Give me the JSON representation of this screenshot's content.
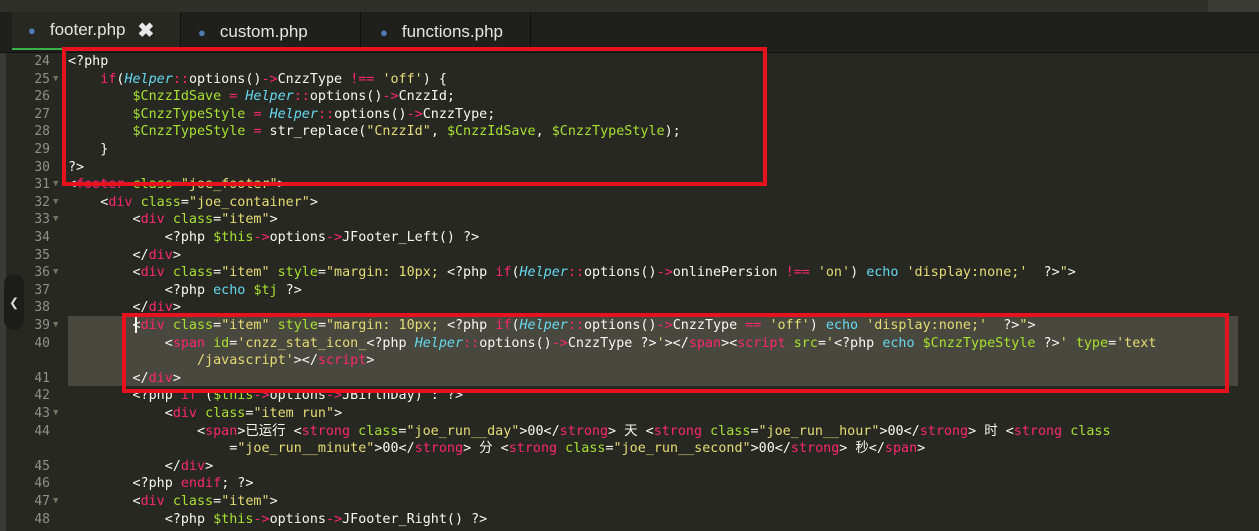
{
  "tabs": [
    {
      "label": "footer.php",
      "active": true,
      "close": "✖"
    },
    {
      "label": "custom.php",
      "active": false
    },
    {
      "label": "functions.php",
      "active": false
    }
  ],
  "lines": [
    {
      "n": "24",
      "fold": false,
      "tokens": [
        [
          "t-plain",
          "<?php"
        ]
      ]
    },
    {
      "n": "25",
      "fold": true,
      "tokens": [
        [
          "t-plain",
          "    "
        ],
        [
          "t-kw",
          "if"
        ],
        [
          "t-plain",
          "("
        ],
        [
          "t-cls",
          "Helper"
        ],
        [
          "t-op",
          "::"
        ],
        [
          "t-plain",
          "options()"
        ],
        [
          "t-op",
          "->"
        ],
        [
          "t-plain",
          "CnzzType "
        ],
        [
          "t-op",
          "!=="
        ],
        [
          "t-plain",
          " "
        ],
        [
          "t-str",
          "'off'"
        ],
        [
          "t-plain",
          ") {"
        ]
      ]
    },
    {
      "n": "26",
      "fold": false,
      "tokens": [
        [
          "t-plain",
          "        "
        ],
        [
          "t-var",
          "$CnzzIdSave"
        ],
        [
          "t-plain",
          " "
        ],
        [
          "t-op",
          "="
        ],
        [
          "t-plain",
          " "
        ],
        [
          "t-cls",
          "Helper"
        ],
        [
          "t-op",
          "::"
        ],
        [
          "t-plain",
          "options()"
        ],
        [
          "t-op",
          "->"
        ],
        [
          "t-plain",
          "CnzzId;"
        ]
      ]
    },
    {
      "n": "27",
      "fold": false,
      "tokens": [
        [
          "t-plain",
          "        "
        ],
        [
          "t-var",
          "$CnzzTypeStyle"
        ],
        [
          "t-plain",
          " "
        ],
        [
          "t-op",
          "="
        ],
        [
          "t-plain",
          " "
        ],
        [
          "t-cls",
          "Helper"
        ],
        [
          "t-op",
          "::"
        ],
        [
          "t-plain",
          "options()"
        ],
        [
          "t-op",
          "->"
        ],
        [
          "t-plain",
          "CnzzType;"
        ]
      ]
    },
    {
      "n": "28",
      "fold": false,
      "tokens": [
        [
          "t-plain",
          "        "
        ],
        [
          "t-var",
          "$CnzzTypeStyle"
        ],
        [
          "t-plain",
          " "
        ],
        [
          "t-op",
          "="
        ],
        [
          "t-plain",
          " str_replace("
        ],
        [
          "t-str",
          "\"CnzzId\""
        ],
        [
          "t-plain",
          ", "
        ],
        [
          "t-var",
          "$CnzzIdSave"
        ],
        [
          "t-plain",
          ", "
        ],
        [
          "t-var",
          "$CnzzTypeStyle"
        ],
        [
          "t-plain",
          ");"
        ]
      ]
    },
    {
      "n": "29",
      "fold": false,
      "tokens": [
        [
          "t-plain",
          "    }"
        ]
      ]
    },
    {
      "n": "30",
      "fold": false,
      "tokens": [
        [
          "t-plain",
          "?>"
        ]
      ]
    },
    {
      "n": "31",
      "fold": true,
      "tokens": [
        [
          "t-plain",
          "<"
        ],
        [
          "t-tag",
          "footer"
        ],
        [
          "t-plain",
          " "
        ],
        [
          "t-attr",
          "class"
        ],
        [
          "t-plain",
          "="
        ],
        [
          "t-str",
          "\"joe_footer\""
        ],
        [
          "t-plain",
          ">"
        ]
      ]
    },
    {
      "n": "32",
      "fold": true,
      "tokens": [
        [
          "t-plain",
          "    <"
        ],
        [
          "t-tag",
          "div"
        ],
        [
          "t-plain",
          " "
        ],
        [
          "t-attr",
          "class"
        ],
        [
          "t-plain",
          "="
        ],
        [
          "t-str",
          "\"joe_container\""
        ],
        [
          "t-plain",
          ">"
        ]
      ]
    },
    {
      "n": "33",
      "fold": true,
      "tokens": [
        [
          "t-plain",
          "        <"
        ],
        [
          "t-tag",
          "div"
        ],
        [
          "t-plain",
          " "
        ],
        [
          "t-attr",
          "class"
        ],
        [
          "t-plain",
          "="
        ],
        [
          "t-str",
          "\"item\""
        ],
        [
          "t-plain",
          ">"
        ]
      ]
    },
    {
      "n": "34",
      "fold": false,
      "tokens": [
        [
          "t-plain",
          "            <?php "
        ],
        [
          "t-var",
          "$this"
        ],
        [
          "t-op",
          "->"
        ],
        [
          "t-plain",
          "options"
        ],
        [
          "t-op",
          "->"
        ],
        [
          "t-plain",
          "JFooter_Left() ?>"
        ]
      ]
    },
    {
      "n": "35",
      "fold": false,
      "tokens": [
        [
          "t-plain",
          "        </"
        ],
        [
          "t-tag",
          "div"
        ],
        [
          "t-plain",
          ">"
        ]
      ]
    },
    {
      "n": "36",
      "fold": true,
      "tokens": [
        [
          "t-plain",
          "        <"
        ],
        [
          "t-tag",
          "div"
        ],
        [
          "t-plain",
          " "
        ],
        [
          "t-attr",
          "class"
        ],
        [
          "t-plain",
          "="
        ],
        [
          "t-str",
          "\"item\""
        ],
        [
          "t-plain",
          " "
        ],
        [
          "t-attr",
          "style"
        ],
        [
          "t-plain",
          "="
        ],
        [
          "t-str",
          "\"margin: 10px; "
        ],
        [
          "t-plain",
          "<?php "
        ],
        [
          "t-kw",
          "if"
        ],
        [
          "t-plain",
          "("
        ],
        [
          "t-cls",
          "Helper"
        ],
        [
          "t-op",
          "::"
        ],
        [
          "t-plain",
          "options()"
        ],
        [
          "t-op",
          "->"
        ],
        [
          "t-plain",
          "onlinePersion "
        ],
        [
          "t-op",
          "!=="
        ],
        [
          "t-plain",
          " "
        ],
        [
          "t-str",
          "'on'"
        ],
        [
          "t-plain",
          ") "
        ],
        [
          "t-echo",
          "echo"
        ],
        [
          "t-plain",
          " "
        ],
        [
          "t-str",
          "'display:none;'"
        ],
        [
          "t-plain",
          "  ?>"
        ],
        [
          "t-str",
          "\""
        ],
        [
          "t-plain",
          ">"
        ]
      ]
    },
    {
      "n": "37",
      "fold": false,
      "tokens": [
        [
          "t-plain",
          "            <?php "
        ],
        [
          "t-echo",
          "echo"
        ],
        [
          "t-plain",
          " "
        ],
        [
          "t-var",
          "$tj"
        ],
        [
          "t-plain",
          " ?>"
        ]
      ]
    },
    {
      "n": "38",
      "fold": false,
      "tokens": [
        [
          "t-plain",
          "        </"
        ],
        [
          "t-tag",
          "div"
        ],
        [
          "t-plain",
          ">"
        ]
      ]
    },
    {
      "n": "39",
      "fold": true,
      "tokens": [
        [
          "t-plain",
          "        <"
        ],
        [
          "t-tag",
          "div"
        ],
        [
          "t-plain",
          " "
        ],
        [
          "t-attr",
          "class"
        ],
        [
          "t-plain",
          "="
        ],
        [
          "t-str",
          "\"item\""
        ],
        [
          "t-plain",
          " "
        ],
        [
          "t-attr",
          "style"
        ],
        [
          "t-plain",
          "="
        ],
        [
          "t-str",
          "\"margin: 10px; "
        ],
        [
          "t-plain",
          "<?php "
        ],
        [
          "t-kw",
          "if"
        ],
        [
          "t-plain",
          "("
        ],
        [
          "t-cls",
          "Helper"
        ],
        [
          "t-op",
          "::"
        ],
        [
          "t-plain",
          "options()"
        ],
        [
          "t-op",
          "->"
        ],
        [
          "t-plain",
          "CnzzType "
        ],
        [
          "t-op",
          "=="
        ],
        [
          "t-plain",
          " "
        ],
        [
          "t-str",
          "'off'"
        ],
        [
          "t-plain",
          ") "
        ],
        [
          "t-echo",
          "echo"
        ],
        [
          "t-plain",
          " "
        ],
        [
          "t-str",
          "'display:none;'"
        ],
        [
          "t-plain",
          "  ?>"
        ],
        [
          "t-str",
          "\""
        ],
        [
          "t-plain",
          ">"
        ]
      ]
    },
    {
      "n": "40",
      "fold": false,
      "tokens": [
        [
          "t-plain",
          "            <"
        ],
        [
          "t-tag",
          "span"
        ],
        [
          "t-plain",
          " "
        ],
        [
          "t-attr",
          "id"
        ],
        [
          "t-plain",
          "="
        ],
        [
          "t-str",
          "'cnzz_stat_icon_"
        ],
        [
          "t-plain",
          "<?php "
        ],
        [
          "t-cls",
          "Helper"
        ],
        [
          "t-op",
          "::"
        ],
        [
          "t-plain",
          "options()"
        ],
        [
          "t-op",
          "->"
        ],
        [
          "t-plain",
          "CnzzType ?>"
        ],
        [
          "t-str",
          "'"
        ],
        [
          "t-plain",
          "></"
        ],
        [
          "t-tag",
          "span"
        ],
        [
          "t-plain",
          "><"
        ],
        [
          "t-tag",
          "script"
        ],
        [
          "t-plain",
          " "
        ],
        [
          "t-attr",
          "src"
        ],
        [
          "t-plain",
          "="
        ],
        [
          "t-str",
          "'"
        ],
        [
          "t-plain",
          "<?php "
        ],
        [
          "t-echo",
          "echo"
        ],
        [
          "t-plain",
          " "
        ],
        [
          "t-var",
          "$CnzzTypeStyle"
        ],
        [
          "t-plain",
          " ?>"
        ],
        [
          "t-str",
          "'"
        ],
        [
          "t-plain",
          " "
        ],
        [
          "t-attr",
          "type"
        ],
        [
          "t-plain",
          "="
        ],
        [
          "t-str",
          "'text"
        ]
      ]
    },
    {
      "n": "",
      "fold": false,
      "tokens": [
        [
          "t-str",
          "                /javascript'"
        ],
        [
          "t-plain",
          "></"
        ],
        [
          "t-tag",
          "script"
        ],
        [
          "t-plain",
          ">"
        ]
      ]
    },
    {
      "n": "41",
      "fold": false,
      "tokens": [
        [
          "t-plain",
          "        </"
        ],
        [
          "t-tag",
          "div"
        ],
        [
          "t-plain",
          ">"
        ]
      ]
    },
    {
      "n": "42",
      "fold": false,
      "tokens": [
        [
          "t-plain",
          "        <?php "
        ],
        [
          "t-kw",
          "if"
        ],
        [
          "t-plain",
          " ("
        ],
        [
          "t-var",
          "$this"
        ],
        [
          "t-op",
          "->"
        ],
        [
          "t-plain",
          "options"
        ],
        [
          "t-op",
          "->"
        ],
        [
          "t-plain",
          "JBirthDay) : ?>"
        ]
      ]
    },
    {
      "n": "43",
      "fold": true,
      "tokens": [
        [
          "t-plain",
          "            <"
        ],
        [
          "t-tag",
          "div"
        ],
        [
          "t-plain",
          " "
        ],
        [
          "t-attr",
          "class"
        ],
        [
          "t-plain",
          "="
        ],
        [
          "t-str",
          "\"item run\""
        ],
        [
          "t-plain",
          ">"
        ]
      ]
    },
    {
      "n": "44",
      "fold": false,
      "tokens": [
        [
          "t-plain",
          "                <"
        ],
        [
          "t-tag",
          "span"
        ],
        [
          "t-plain",
          ">已运行 <"
        ],
        [
          "t-tag",
          "strong"
        ],
        [
          "t-plain",
          " "
        ],
        [
          "t-attr",
          "class"
        ],
        [
          "t-plain",
          "="
        ],
        [
          "t-str",
          "\"joe_run__day\""
        ],
        [
          "t-plain",
          ">00</"
        ],
        [
          "t-tag",
          "strong"
        ],
        [
          "t-plain",
          "> 天 <"
        ],
        [
          "t-tag",
          "strong"
        ],
        [
          "t-plain",
          " "
        ],
        [
          "t-attr",
          "class"
        ],
        [
          "t-plain",
          "="
        ],
        [
          "t-str",
          "\"joe_run__hour\""
        ],
        [
          "t-plain",
          ">00</"
        ],
        [
          "t-tag",
          "strong"
        ],
        [
          "t-plain",
          "> 时 <"
        ],
        [
          "t-tag",
          "strong"
        ],
        [
          "t-plain",
          " "
        ],
        [
          "t-attr",
          "class"
        ]
      ]
    },
    {
      "n": "",
      "fold": false,
      "tokens": [
        [
          "t-plain",
          "                    ="
        ],
        [
          "t-str",
          "\"joe_run__minute\""
        ],
        [
          "t-plain",
          ">00</"
        ],
        [
          "t-tag",
          "strong"
        ],
        [
          "t-plain",
          "> 分 <"
        ],
        [
          "t-tag",
          "strong"
        ],
        [
          "t-plain",
          " "
        ],
        [
          "t-attr",
          "class"
        ],
        [
          "t-plain",
          "="
        ],
        [
          "t-str",
          "\"joe_run__second\""
        ],
        [
          "t-plain",
          ">00</"
        ],
        [
          "t-tag",
          "strong"
        ],
        [
          "t-plain",
          "> 秒</"
        ],
        [
          "t-tag",
          "span"
        ],
        [
          "t-plain",
          ">"
        ]
      ]
    },
    {
      "n": "45",
      "fold": false,
      "tokens": [
        [
          "t-plain",
          "            </"
        ],
        [
          "t-tag",
          "div"
        ],
        [
          "t-plain",
          ">"
        ]
      ]
    },
    {
      "n": "46",
      "fold": false,
      "tokens": [
        [
          "t-plain",
          "        <?php "
        ],
        [
          "t-kw",
          "endif"
        ],
        [
          "t-plain",
          "; ?>"
        ]
      ]
    },
    {
      "n": "47",
      "fold": true,
      "tokens": [
        [
          "t-plain",
          "        <"
        ],
        [
          "t-tag",
          "div"
        ],
        [
          "t-plain",
          " "
        ],
        [
          "t-attr",
          "class"
        ],
        [
          "t-plain",
          "="
        ],
        [
          "t-str",
          "\"item\""
        ],
        [
          "t-plain",
          ">"
        ]
      ]
    },
    {
      "n": "48",
      "fold": false,
      "tokens": [
        [
          "t-plain",
          "            <?php "
        ],
        [
          "t-var",
          "$this"
        ],
        [
          "t-op",
          "->"
        ],
        [
          "t-plain",
          "options"
        ],
        [
          "t-op",
          "->"
        ],
        [
          "t-plain",
          "JFooter_Right() ?>"
        ]
      ]
    }
  ],
  "side_handle_icon": "❮",
  "colors": {
    "background": "#272822",
    "annotation": "#e8121f",
    "selection": "#49483e",
    "tab_active_underline": "#35b24a"
  }
}
